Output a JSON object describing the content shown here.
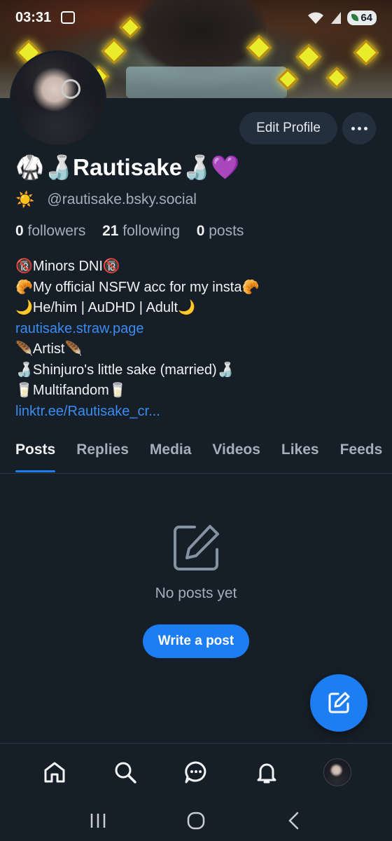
{
  "status_bar": {
    "time": "03:31",
    "battery": "64"
  },
  "profile": {
    "edit_label": "Edit Profile",
    "display_name": "🥋🍶Rautisake🍶💜",
    "handle_emoji": "☀️",
    "handle": "@rautisake.bsky.social",
    "followers_count": "0",
    "followers_label": "followers",
    "following_count": "21",
    "following_label": "following",
    "posts_count": "0",
    "posts_label": "posts",
    "bio": [
      {
        "text": "🔞Minors DNI🔞",
        "link": false
      },
      {
        "text": "🥐My official NSFW acc for my insta🥐",
        "link": false
      },
      {
        "text": "🌙He/him | AuDHD | Adult🌙",
        "link": false
      },
      {
        "text": "rautisake.straw.page",
        "link": true
      },
      {
        "text": "🪶Artist🪶",
        "link": false
      },
      {
        "text": "🍶Shinjuro's little sake (married)🍶",
        "link": false
      },
      {
        "text": "🥛Multifandom🥛",
        "link": false
      },
      {
        "text": "linktr.ee/Rautisake_cr...",
        "link": true
      }
    ]
  },
  "tabs": [
    "Posts",
    "Replies",
    "Media",
    "Videos",
    "Likes",
    "Feeds"
  ],
  "active_tab": "Posts",
  "empty_state": {
    "message": "No posts yet",
    "button": "Write a post"
  },
  "nav": {
    "icons": [
      "home-icon",
      "search-icon",
      "chat-icon",
      "bell-icon",
      "profile-avatar"
    ]
  },
  "colors": {
    "background": "#161e27",
    "accent": "#1d7df2",
    "link": "#3b8cf1",
    "muted_text": "#a3afbd",
    "button_bg": "#232f3d"
  }
}
